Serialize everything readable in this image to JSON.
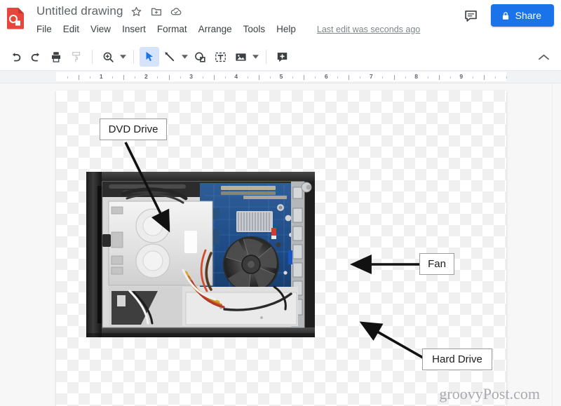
{
  "app": {
    "logo_icon": "google-drawings-logo",
    "doc_title": "Untitled drawing",
    "title_icons": [
      {
        "name": "star-icon",
        "label": "Star"
      },
      {
        "name": "move-to-folder-icon",
        "label": "Move to folder"
      },
      {
        "name": "cloud-saved-icon",
        "label": "Saved to Drive"
      }
    ],
    "menus": [
      "File",
      "Edit",
      "View",
      "Insert",
      "Format",
      "Arrange",
      "Tools",
      "Help"
    ],
    "last_edit": "Last edit was seconds ago",
    "comment_icon": "comment-icon",
    "share": {
      "label": "Share",
      "icon": "lock-icon",
      "color": "#1a73e8"
    }
  },
  "toolbar": {
    "items": [
      {
        "name": "undo-button",
        "icon": "undo-icon",
        "caret": false,
        "active": false
      },
      {
        "name": "redo-button",
        "icon": "redo-icon",
        "caret": false,
        "active": false
      },
      {
        "name": "print-button",
        "icon": "print-icon",
        "caret": false,
        "active": false
      },
      {
        "name": "paint-format-button",
        "icon": "paint-format-icon",
        "caret": false,
        "active": false
      },
      {
        "name": "zoom-button",
        "icon": "zoom-icon",
        "caret": true,
        "active": false
      },
      {
        "name": "select-tool-button",
        "icon": "cursor-arrow-icon",
        "caret": false,
        "active": true
      },
      {
        "name": "line-tool-button",
        "icon": "line-icon",
        "caret": true,
        "active": false
      },
      {
        "name": "shape-tool-button",
        "icon": "shape-icon",
        "caret": false,
        "active": false
      },
      {
        "name": "text-box-button",
        "icon": "text-box-icon",
        "caret": false,
        "active": false
      },
      {
        "name": "image-button",
        "icon": "image-icon",
        "caret": true,
        "active": false
      },
      {
        "name": "add-comment-button",
        "icon": "add-comment-icon",
        "caret": false,
        "active": false
      }
    ],
    "collapse_icon": "chevron-up-icon"
  },
  "ruler": {
    "numbers": [
      1,
      2,
      3,
      4,
      5,
      6,
      7,
      8,
      9
    ],
    "unit": "inch"
  },
  "canvas": {
    "background": "transparent-checkerboard",
    "image_alt": "Opened desktop computer case showing internal components",
    "labels": [
      {
        "name": "callout-dvd-drive",
        "text": "DVD Drive"
      },
      {
        "name": "callout-fan",
        "text": "Fan"
      },
      {
        "name": "callout-hard-drive",
        "text": "Hard Drive"
      }
    ],
    "watermark": "groovyPost.com"
  },
  "colors": {
    "accent": "#1a73e8",
    "toolbar_active": "#d6e4fb",
    "text_primary": "#3c4043",
    "text_secondary": "#5f6368",
    "workarea_bg": "#f7f7f7"
  }
}
